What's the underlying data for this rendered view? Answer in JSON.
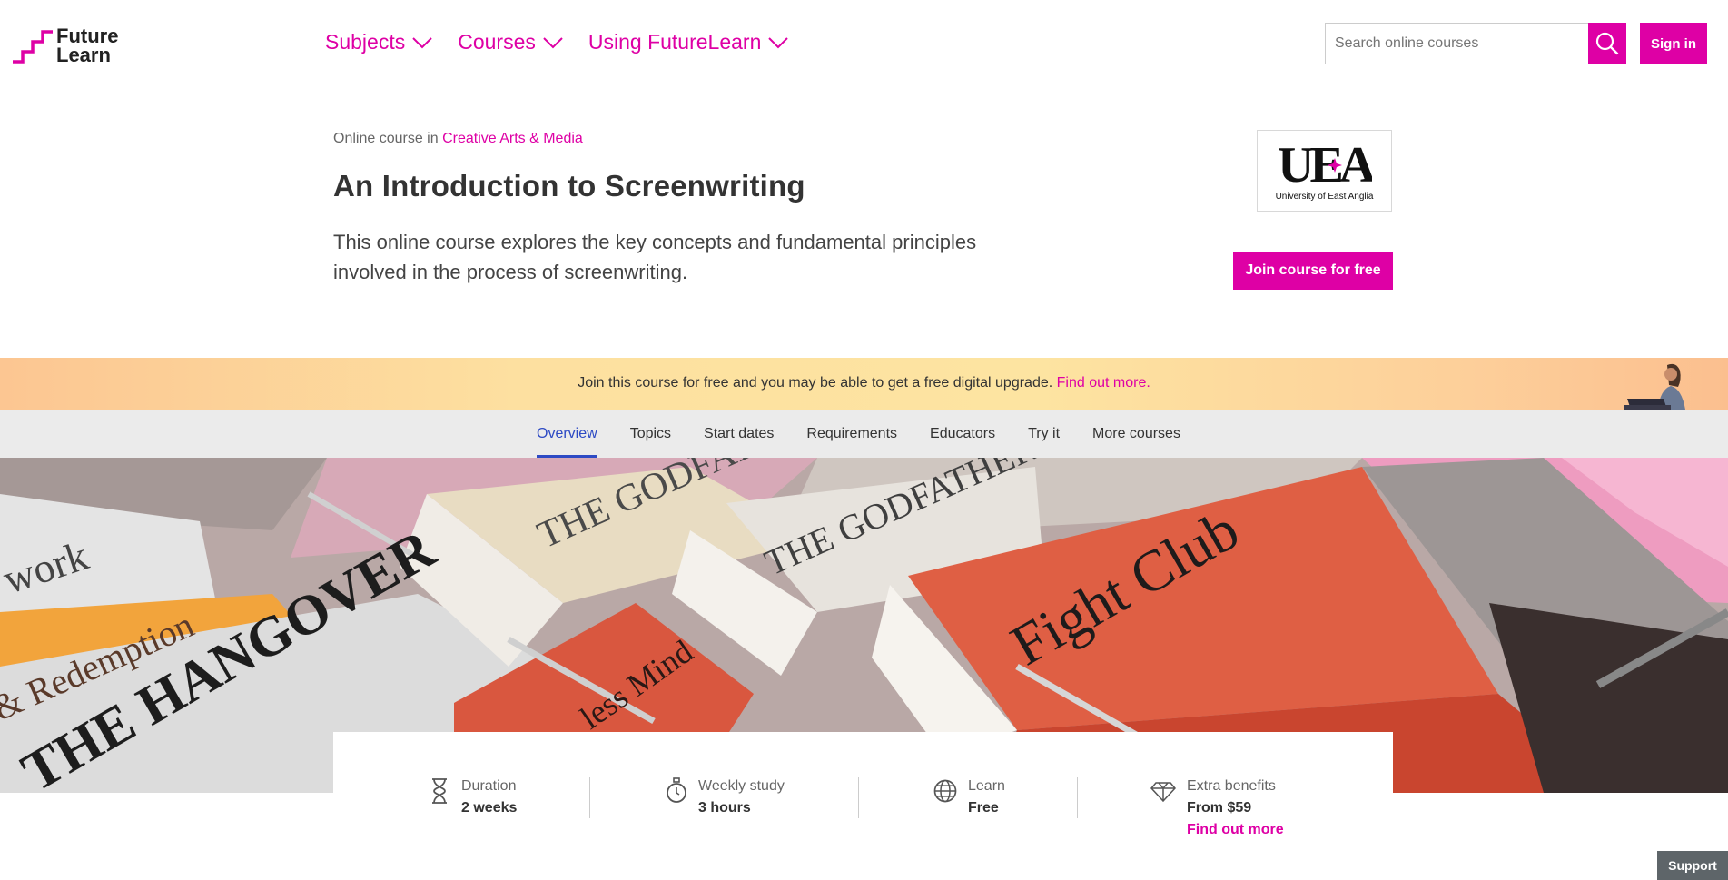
{
  "header": {
    "logo": {
      "line1": "Future",
      "line2": "Learn"
    },
    "nav": [
      {
        "label": "Subjects"
      },
      {
        "label": "Courses"
      },
      {
        "label": "Using FutureLearn"
      }
    ],
    "search": {
      "placeholder": "Search online courses"
    },
    "sign_in": "Sign in"
  },
  "course": {
    "breadcrumb_prefix": "Online course in",
    "breadcrumb_link": "Creative Arts & Media",
    "title": "An Introduction to Screenwriting",
    "description": "This online course explores the key concepts and fundamental principles involved in the process of screenwriting.",
    "university": {
      "mark": "UEA",
      "name": "University of East Anglia"
    },
    "join_button": "Join course for free"
  },
  "banner": {
    "text": "Join this course for free and you may be able to get a free digital upgrade.",
    "link": "Find out more."
  },
  "tabs": [
    {
      "label": "Overview",
      "active": true
    },
    {
      "label": "Topics"
    },
    {
      "label": "Start dates"
    },
    {
      "label": "Requirements"
    },
    {
      "label": "Educators"
    },
    {
      "label": "Try it"
    },
    {
      "label": "More courses"
    }
  ],
  "hero_image": {
    "book_titles": [
      "work",
      "& Redemption",
      "THE HANGOVER",
      "THE GODFATHER",
      "THE GODFATHER PT.II",
      "Fight Club",
      "less Mind"
    ]
  },
  "stats": {
    "duration": {
      "label": "Duration",
      "value": "2 weeks",
      "icon": "hourglass-icon"
    },
    "weekly": {
      "label": "Weekly study",
      "value": "3 hours",
      "icon": "stopwatch-icon"
    },
    "learn": {
      "label": "Learn",
      "value": "Free",
      "icon": "globe-icon"
    },
    "extra": {
      "label": "Extra benefits",
      "value": "From $59",
      "link": "Find out more",
      "icon": "diamond-icon"
    }
  },
  "support": "Support",
  "colors": {
    "brand": "#de00a5",
    "tab_active": "#2d4ac4",
    "tabs_bg": "#ebebeb"
  }
}
